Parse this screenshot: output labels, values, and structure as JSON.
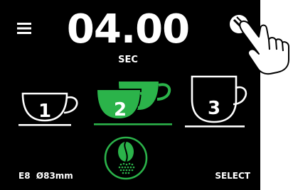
{
  "display": {
    "time_value": "04.00",
    "time_unit": "SEC",
    "grind_setting": "E8  Ø83mm",
    "select_label": "SELECT"
  },
  "cups": [
    {
      "number": "1",
      "selected": false
    },
    {
      "number": "2",
      "selected": true
    },
    {
      "number": "3",
      "selected": false
    }
  ],
  "icons": {
    "menu": "hamburger-menu-icon",
    "settings": "wrench-icon",
    "grind": "coffee-bean-grind-icon",
    "hand": "pointing-hand-icon"
  },
  "colors": {
    "background": "#000000",
    "foreground": "#ffffff",
    "accent": "#2bb34a"
  }
}
